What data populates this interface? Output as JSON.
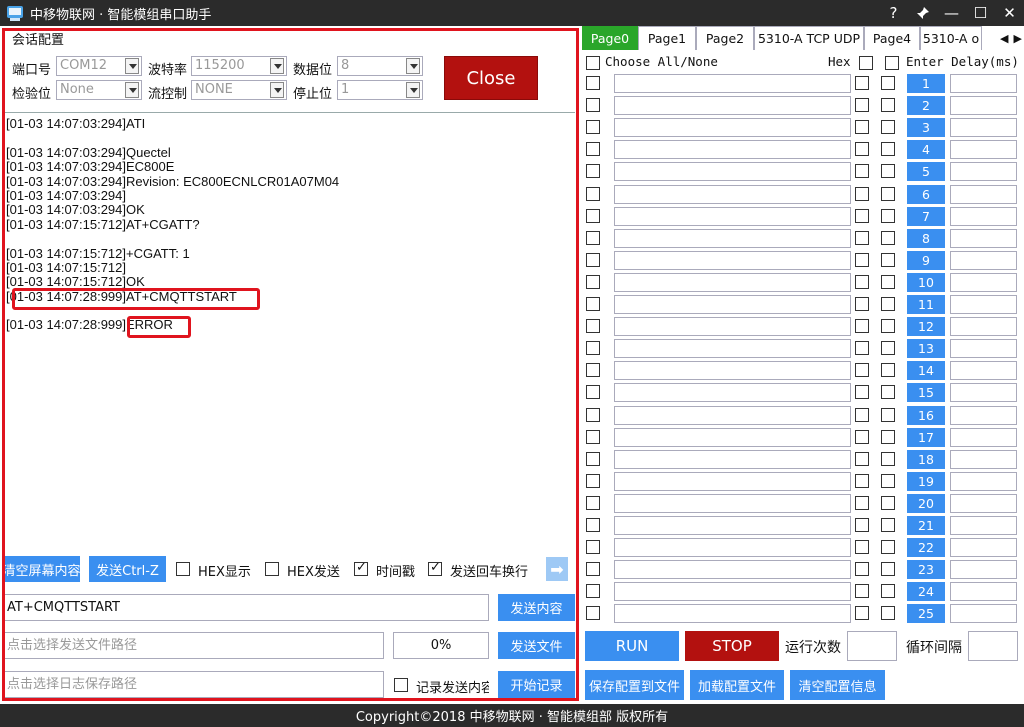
{
  "window": {
    "title": "中移物联网 · 智能模组串口助手",
    "controls": [
      "?",
      "📌",
      "—",
      "☐",
      "✕"
    ]
  },
  "session": {
    "section_title": "会话配置",
    "port_label": "端口号",
    "port_value": "COM12",
    "baud_label": "波特率",
    "baud_value": "115200",
    "databits_label": "数据位",
    "databits_value": "8",
    "parity_label": "检验位",
    "parity_value": "None",
    "flow_label": "流控制",
    "flow_value": "NONE",
    "stopbits_label": "停止位",
    "stopbits_value": "1",
    "close_label": "Close"
  },
  "log": {
    "lines": [
      "[01-03 14:07:03:294]ATI",
      "",
      "[01-03 14:07:03:294]Quectel",
      "[01-03 14:07:03:294]EC800E",
      "[01-03 14:07:03:294]Revision: EC800ECNLCR01A07M04",
      "[01-03 14:07:03:294]",
      "[01-03 14:07:03:294]OK",
      "[01-03 14:07:15:712]AT+CGATT?",
      "",
      "[01-03 14:07:15:712]+CGATT: 1",
      "[01-03 14:07:15:712]",
      "[01-03 14:07:15:712]OK",
      "[01-03 14:07:28:999]AT+CMQTTSTART",
      "",
      "[01-03 14:07:28:999]ERROR"
    ]
  },
  "controls": {
    "clear_label": "清空屏幕内容",
    "send_ctrlz_label": "发送Ctrl-Z",
    "hex_display_label": "HEX显示",
    "hex_display_checked": false,
    "hex_send_label": "HEX发送",
    "hex_send_checked": false,
    "timestamp_label": "时间戳",
    "timestamp_checked": true,
    "send_crlf_label": "发送回车换行",
    "send_crlf_checked": true,
    "arrow_icon": "right-arrow-icon",
    "send_input_value": "AT+CMQTTSTART",
    "send_content_label": "发送内容",
    "file_path_placeholder": "点击选择发送文件路径",
    "progress_text": "0%",
    "progress_value": 0,
    "send_file_label": "发送文件",
    "log_path_placeholder": "点击选择日志保存路径",
    "record_send_label": "记录发送内容",
    "record_send_checked": false,
    "start_record_label": "开始记录"
  },
  "tabs": [
    {
      "label": "Page0",
      "active": true
    },
    {
      "label": "Page1",
      "active": false
    },
    {
      "label": "Page2",
      "active": false
    },
    {
      "label": "5310-A TCP UDP",
      "active": false
    },
    {
      "label": "Page4",
      "active": false
    },
    {
      "label": "5310-A o",
      "active": false
    }
  ],
  "commands": {
    "choose_all_label": "Choose All/None",
    "hex_label": "Hex",
    "enter_delay_label": "Enter Delay(ms)",
    "rows": [
      "1",
      "2",
      "3",
      "4",
      "5",
      "6",
      "7",
      "8",
      "9",
      "10",
      "11",
      "12",
      "13",
      "14",
      "15",
      "16",
      "17",
      "18",
      "19",
      "20",
      "21",
      "22",
      "23",
      "24",
      "25"
    ]
  },
  "run": {
    "run_label": "RUN",
    "stop_label": "STOP",
    "run_count_label": "运行次数",
    "loop_interval_label": "循环间隔",
    "save_config_label": "保存配置到文件",
    "load_config_label": "加载配置文件",
    "clear_config_label": "清空配置信息"
  },
  "status": {
    "copyright": "Copyright©2018 中移物联网 · 智能模组部    版权所有"
  },
  "colors": {
    "accent_blue": "#3a8ff0",
    "stop_red": "#b3110f",
    "active_tab_green": "#2aa62a",
    "highlight_red": "#e0141e",
    "titlebar": "#2b2b2b"
  }
}
